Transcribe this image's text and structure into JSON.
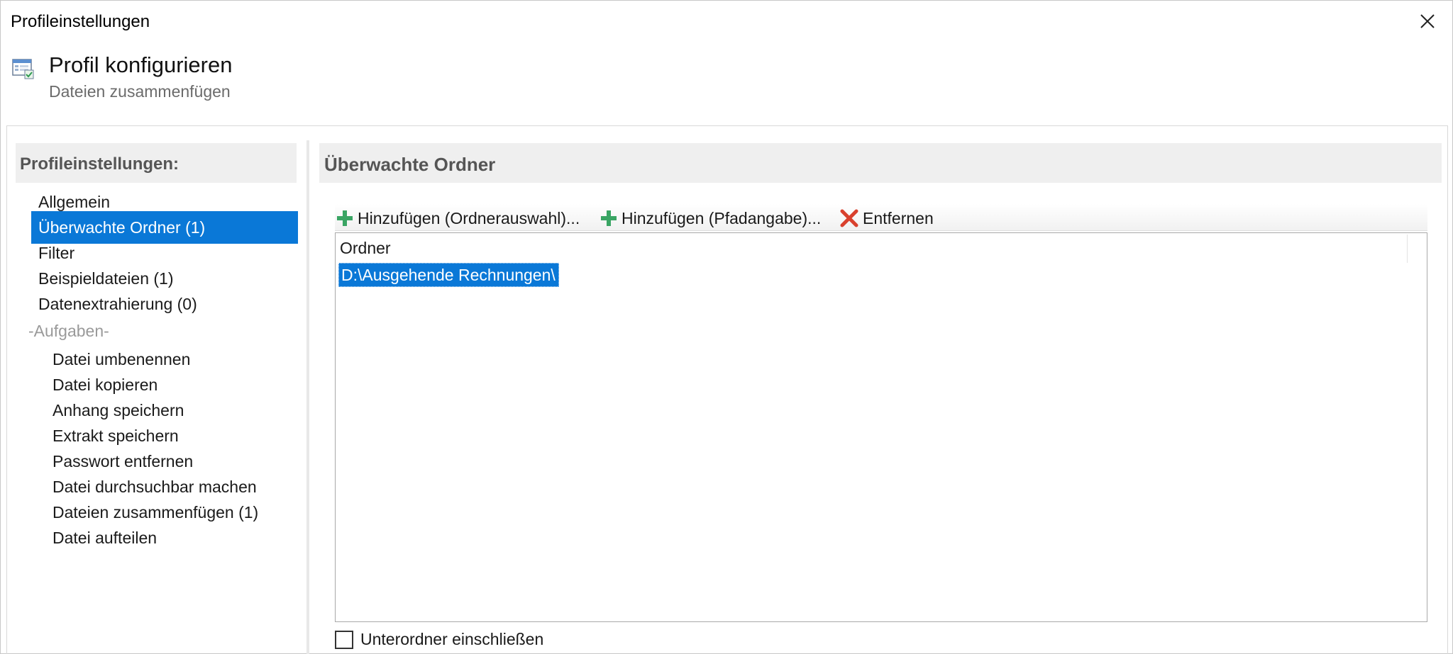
{
  "window": {
    "title": "Profileinstellungen"
  },
  "header": {
    "title": "Profil konfigurieren",
    "subtitle": "Dateien zusammenfügen"
  },
  "sidebar": {
    "heading": "Profileinstellungen:",
    "items": [
      {
        "label": "Allgemein",
        "selected": false
      },
      {
        "label": "Überwachte Ordner (1)",
        "selected": true
      },
      {
        "label": "Filter",
        "selected": false
      },
      {
        "label": "Beispieldateien (1)",
        "selected": false
      },
      {
        "label": "Datenextrahierung (0)",
        "selected": false
      }
    ],
    "group_label": "-Aufgaben-",
    "tasks": [
      "Datei umbenennen",
      "Datei kopieren",
      "Anhang speichern",
      "Extrakt speichern",
      "Passwort entfernen",
      "Datei durchsuchbar machen",
      "Dateien zusammenfügen (1)",
      "Datei aufteilen"
    ]
  },
  "main": {
    "heading": "Überwachte Ordner",
    "toolbar": {
      "add_select_label": "Hinzufügen (Ordnerauswahl)...",
      "add_path_label": "Hinzufügen (Pfadangabe)...",
      "remove_label": "Entfernen"
    },
    "list": {
      "column_header": "Ordner",
      "rows": [
        "D:\\Ausgehende Rechnungen\\"
      ]
    },
    "subfolder_checkbox": {
      "label": "Unterordner einschließen",
      "checked": false
    }
  },
  "colors": {
    "accent": "#0a78d7",
    "add_icon": "#3aa564",
    "remove_icon": "#d9412e"
  },
  "icons": {
    "close": "close-icon",
    "profile": "profile-settings-icon",
    "add": "plus-icon",
    "remove": "x-icon"
  }
}
